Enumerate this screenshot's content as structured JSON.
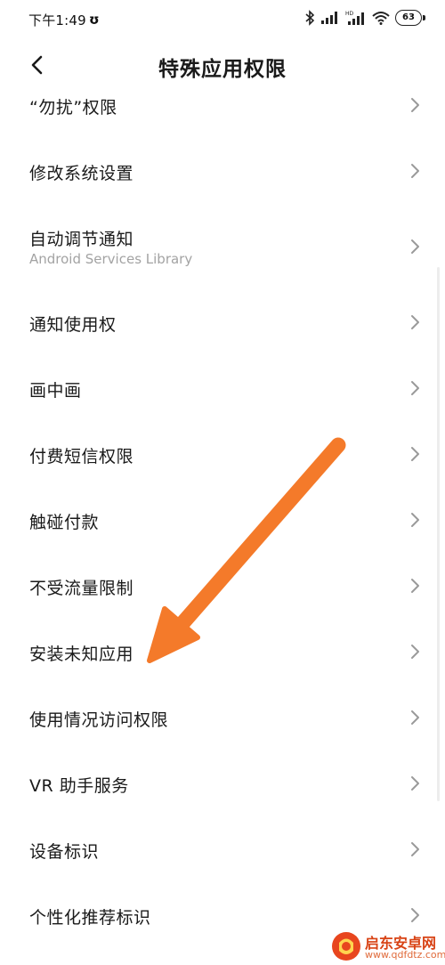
{
  "status_bar": {
    "time": "下午1:49",
    "alarm_glyph": "ʊ",
    "battery": "63",
    "icons": [
      "bluetooth-icon",
      "cell-signal-icon",
      "hd-signal-icon",
      "wifi-icon",
      "battery-icon"
    ]
  },
  "header": {
    "title": "特殊应用权限",
    "back_icon": "chevron-left-icon"
  },
  "list": {
    "items": [
      {
        "label": "“勿扰”权限",
        "subtitle": ""
      },
      {
        "label": "修改系统设置",
        "subtitle": ""
      },
      {
        "label": "自动调节通知",
        "subtitle": "Android Services Library"
      },
      {
        "label": "通知使用权",
        "subtitle": ""
      },
      {
        "label": "画中画",
        "subtitle": ""
      },
      {
        "label": "付费短信权限",
        "subtitle": ""
      },
      {
        "label": "触碰付款",
        "subtitle": ""
      },
      {
        "label": "不受流量限制",
        "subtitle": ""
      },
      {
        "label": "安装未知应用",
        "subtitle": ""
      },
      {
        "label": "使用情况访问权限",
        "subtitle": ""
      },
      {
        "label": "VR 助手服务",
        "subtitle": ""
      },
      {
        "label": "设备标识",
        "subtitle": ""
      },
      {
        "label": "个性化推荐标识",
        "subtitle": ""
      }
    ],
    "chevron_icon": "chevron-right-icon"
  },
  "annotation": {
    "arrow_color": "#f47a2a",
    "points_to": "安装未知应用"
  },
  "watermark": {
    "name": "启东安卓网",
    "url": "www.qdfdtz.com"
  },
  "colors": {
    "text": "#1a1a1a",
    "subtitle": "#a3a3a3",
    "chevron": "#9a9a9a",
    "accent": "#f47a2a"
  }
}
